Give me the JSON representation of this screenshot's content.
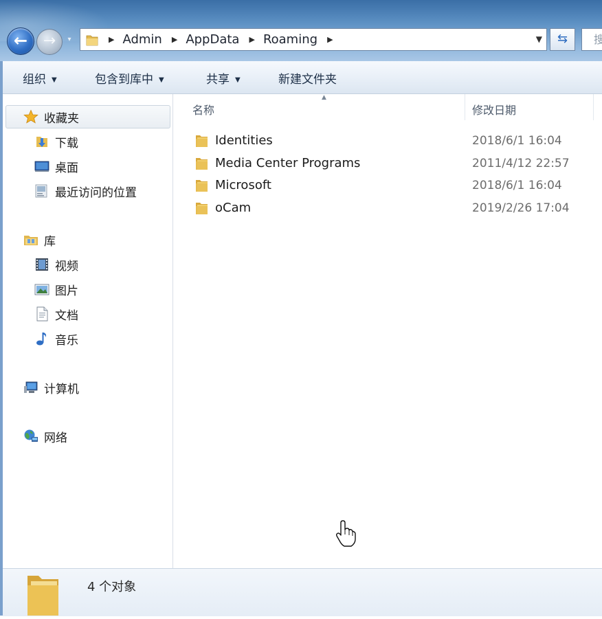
{
  "navigation": {
    "back_glyph": "←",
    "forward_glyph": "→",
    "history_dropdown_glyph": "▾",
    "refresh_glyph": "⇆",
    "search_placeholder": "搜"
  },
  "address": {
    "breadcrumbs": [
      "Admin",
      "AppData",
      "Roaming"
    ],
    "separator_glyph": "▶",
    "dropdown_glyph": "▼"
  },
  "toolbar": {
    "organize_label": "组织",
    "include_in_library_label": "包含到库中",
    "share_label": "共享",
    "new_folder_label": "新建文件夹",
    "caret_glyph": "▼"
  },
  "sidebar": {
    "favorites": {
      "label": "收藏夹",
      "icon": "star-icon",
      "items": [
        {
          "label": "下载",
          "icon": "download-folder-icon"
        },
        {
          "label": "桌面",
          "icon": "desktop-icon"
        },
        {
          "label": "最近访问的位置",
          "icon": "recent-places-icon"
        }
      ]
    },
    "libraries": {
      "label": "库",
      "icon": "library-icon",
      "items": [
        {
          "label": "视频",
          "icon": "video-icon"
        },
        {
          "label": "图片",
          "icon": "picture-icon"
        },
        {
          "label": "文档",
          "icon": "document-icon"
        },
        {
          "label": "音乐",
          "icon": "music-icon"
        }
      ]
    },
    "computer": {
      "label": "计算机",
      "icon": "computer-icon"
    },
    "network": {
      "label": "网络",
      "icon": "network-icon"
    }
  },
  "filelist": {
    "columns": {
      "name": "名称",
      "date_modified": "修改日期"
    },
    "sort_glyph": "▲",
    "rows": [
      {
        "name": "Identities",
        "date": "2018/6/1 16:04",
        "icon": "folder-icon"
      },
      {
        "name": "Media Center Programs",
        "date": "2011/4/12 22:57",
        "icon": "folder-icon"
      },
      {
        "name": "Microsoft",
        "date": "2018/6/1 16:04",
        "icon": "folder-icon"
      },
      {
        "name": "oCam",
        "date": "2019/2/26 17:04",
        "icon": "folder-icon"
      }
    ]
  },
  "status": {
    "count_text": "4 个对象",
    "icon": "folder-icon"
  },
  "colors": {
    "title_gradient_top": "#3a6ea6",
    "toolbar_bg": "#e9f0f8",
    "folder_yellow": "#e8c25a",
    "accent_blue": "#2f6ec4"
  }
}
